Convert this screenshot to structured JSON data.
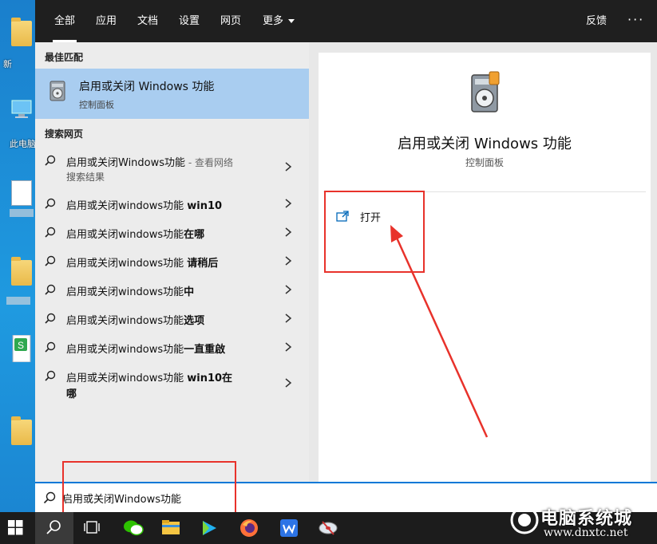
{
  "desktop": {
    "labels": [
      "新",
      "此电脑"
    ]
  },
  "tabs": [
    {
      "label": "全部",
      "active": true
    },
    {
      "label": "应用"
    },
    {
      "label": "文档"
    },
    {
      "label": "设置"
    },
    {
      "label": "网页"
    },
    {
      "label": "更多"
    }
  ],
  "header": {
    "feedback": "反馈",
    "more_options": "···"
  },
  "best_match": {
    "section": "最佳匹配",
    "title": "启用或关闭 Windows 功能",
    "subtitle": "控制面板"
  },
  "web_search": {
    "section": "搜索网页",
    "items": [
      {
        "text": "启用或关闭Windows功能",
        "bold": "",
        "suffix": " - 查看网络",
        "line2": "搜索结果"
      },
      {
        "text": "启用或关闭windows功能 ",
        "bold": "win10"
      },
      {
        "text": "启用或关闭windows功能",
        "bold": "在哪"
      },
      {
        "text": "启用或关闭windows功能 ",
        "bold": "请稍后"
      },
      {
        "text": "启用或关闭windows功能",
        "bold": "中"
      },
      {
        "text": "启用或关闭windows功能",
        "bold": "选项"
      },
      {
        "text": "启用或关闭windows功能",
        "bold": "一直重啟"
      },
      {
        "text": "启用或关闭windows功能 ",
        "bold": "win10在",
        "line2": "哪"
      }
    ]
  },
  "detail": {
    "title": "启用或关闭 Windows 功能",
    "subtitle": "控制面板",
    "action_open": "打开"
  },
  "search": {
    "value": "启用或关闭Windows功能"
  },
  "watermark": {
    "line1": "电脑系统城",
    "line2": "www.dnxtc.net"
  },
  "colors": {
    "accent": "#0078d7",
    "highlight": "#a9cdf0",
    "annotation": "#e8322b",
    "topbar": "#1f1f1f"
  }
}
